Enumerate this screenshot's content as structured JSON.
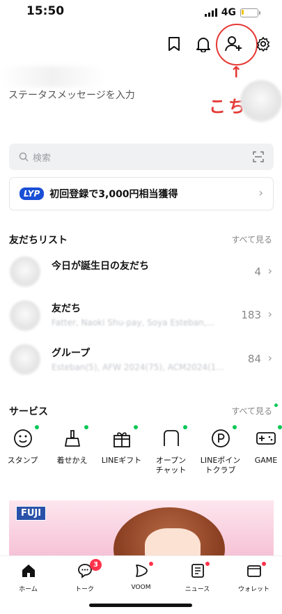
{
  "status_bar": {
    "time": "15:50",
    "network": "4G"
  },
  "header": {
    "annotation_arrow": "↑",
    "annotation_text": "こちら"
  },
  "profile": {
    "status_message_placeholder": "ステータスメッセージを入力"
  },
  "search": {
    "placeholder": "検索"
  },
  "banner": {
    "logo": "LYP",
    "text": "初回登録で3,000円相当獲得"
  },
  "friends": {
    "title": "友だちリスト",
    "see_all": "すべて見る",
    "rows": [
      {
        "title": "今日が誕生日の友だち",
        "subtitle": "",
        "count": "4"
      },
      {
        "title": "友だち",
        "subtitle": "Fatter, Naoki Shu-pay, Soya Esteban,...",
        "count": "183"
      },
      {
        "title": "グループ",
        "subtitle": "Esteban(5), AFW 2024(75), ACM2024(1...",
        "count": "84"
      }
    ]
  },
  "services": {
    "title": "サービス",
    "see_all": "すべて見る",
    "items": [
      {
        "label": "スタンプ",
        "icon": "smile-icon"
      },
      {
        "label": "着せかえ",
        "icon": "brush-icon"
      },
      {
        "label": "LINEギフト",
        "icon": "gift-icon"
      },
      {
        "label": "オープン\nチャット",
        "icon": "openchat-icon"
      },
      {
        "label": "LINEポイン\nトクラブ",
        "icon": "points-icon"
      },
      {
        "label": "GAME",
        "icon": "game-icon"
      }
    ]
  },
  "promo": {
    "brand": "FUJI"
  },
  "tabs": [
    {
      "label": "ホーム",
      "icon": "home-icon"
    },
    {
      "label": "トーク",
      "icon": "chat-icon",
      "badge": "3"
    },
    {
      "label": "VOOM",
      "icon": "voom-icon"
    },
    {
      "label": "ニュース",
      "icon": "news-icon"
    },
    {
      "label": "ウォレット",
      "icon": "wallet-icon"
    }
  ],
  "colors": {
    "accent_red": "#e53935",
    "line_green": "#06c755",
    "badge_red": "#ff334b",
    "lyp_blue": "#1a4fd6"
  }
}
